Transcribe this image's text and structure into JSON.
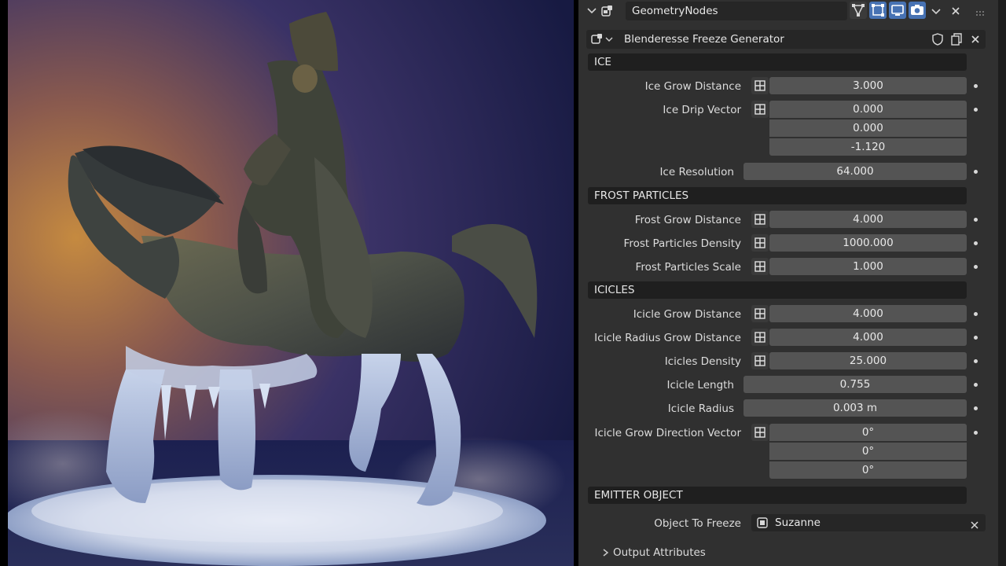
{
  "modifier": {
    "name": "GeometryNodes",
    "node_group": "Blenderesse Freeze Generator"
  },
  "sections": {
    "ice": "ICE",
    "frost": "FROST PARTICLES",
    "icicles": "ICICLES",
    "emitter": "EMITTER OBJECT"
  },
  "fields": {
    "ice_grow_distance": {
      "label": "Ice Grow Distance",
      "value": "3.000"
    },
    "ice_drip_vector": {
      "label": "Ice Drip Vector",
      "x": "0.000",
      "y": "0.000",
      "z": "-1.120"
    },
    "ice_resolution": {
      "label": "Ice Resolution",
      "value": "64.000"
    },
    "frost_grow_distance": {
      "label": "Frost Grow Distance",
      "value": "4.000"
    },
    "frost_particles_density": {
      "label": "Frost Particles Density",
      "value": "1000.000"
    },
    "frost_particles_scale": {
      "label": "Frost Particles Scale",
      "value": "1.000"
    },
    "icicle_grow_distance": {
      "label": "Icicle Grow Distance",
      "value": "4.000"
    },
    "icicle_radius_grow_distance": {
      "label": "Icicle Radius Grow Distance",
      "value": "4.000"
    },
    "icicles_density": {
      "label": "Icicles Density",
      "value": "25.000"
    },
    "icicle_length": {
      "label": "Icicle Length",
      "value": "0.755"
    },
    "icicle_radius": {
      "label": "Icicle Radius",
      "value": "0.003 m"
    },
    "icicle_grow_direction_vector": {
      "label": "Icicle Grow Direction Vector",
      "x": "0°",
      "y": "0°",
      "z": "0°"
    },
    "object_to_freeze": {
      "label": "Object To Freeze",
      "value": "Suzanne"
    }
  },
  "output_attributes": "Output Attributes",
  "icons": {
    "collapse": "chevron-down-icon",
    "modifier": "geometry-nodes-icon",
    "edit_mode": "edit-mode-icon",
    "on_cage": "on-cage-icon",
    "viewport": "monitor-icon",
    "render": "camera-icon",
    "close": "close-icon",
    "drag": "drag-handle-icon",
    "fake_user": "shield-icon",
    "duplicate": "duplicate-icon"
  },
  "colors": {
    "panel_bg": "#303030",
    "field_bg": "#545454",
    "header_bg": "#1f1f1f",
    "toggle_active": "#4772b3"
  }
}
